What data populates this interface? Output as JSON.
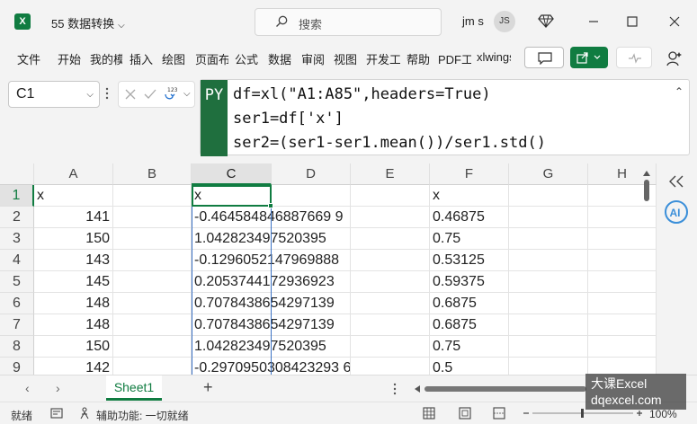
{
  "titlebar": {
    "doc_title": "55 数据转换",
    "search_placeholder": "搜索",
    "user_name": "jm s",
    "avatar_initials": "JS",
    "app_icon_letter": "X",
    "chevron": "⌵"
  },
  "ribbon": {
    "tabs": [
      "文件",
      "开始",
      "我的模板",
      "插入",
      "绘图",
      "页面布局",
      "公式",
      "数据",
      "审阅",
      "视图",
      "开发工具",
      "帮助",
      "PDF工具",
      "xlwings"
    ]
  },
  "formula_bar": {
    "name_box": "C1",
    "py_badge": "PY",
    "code_lines": [
      "df=xl(\"A1:A85\",headers=True)",
      "ser1=df['x']",
      "ser2=(ser1-ser1.mean())/ser1.std()"
    ]
  },
  "grid": {
    "columns": [
      "A",
      "B",
      "C",
      "D",
      "E",
      "F",
      "G",
      "H"
    ],
    "selected_column": "C",
    "rows": [
      {
        "num": "1",
        "A": "x",
        "C": "x",
        "F": "x"
      },
      {
        "num": "2",
        "A": "141",
        "C": "-0.464584846887669 9",
        "F": "0.46875"
      },
      {
        "num": "3",
        "A": "150",
        "C": "1.042823497520395",
        "F": "0.75"
      },
      {
        "num": "4",
        "A": "143",
        "C": "-0.1296052147969888",
        "F": "0.53125"
      },
      {
        "num": "5",
        "A": "145",
        "C": "0.2053744172936923",
        "F": "0.59375"
      },
      {
        "num": "6",
        "A": "148",
        "C": "0.7078438654297139",
        "F": "0.6875"
      },
      {
        "num": "7",
        "A": "148",
        "C": "0.7078438654297139",
        "F": "0.6875"
      },
      {
        "num": "8",
        "A": "150",
        "C": "1.042823497520395",
        "F": "0.75"
      },
      {
        "num": "9",
        "A": "142",
        "C": "-0.2970950308423293 6",
        "F": "0.5"
      }
    ]
  },
  "sheets": {
    "active": "Sheet1",
    "add_label": "+"
  },
  "status": {
    "ready": "就绪",
    "accessibility": "辅助功能: 一切就绪",
    "zoom": "100%"
  },
  "watermark": {
    "line1": "大课Excel",
    "line2": "dqexcel.com"
  },
  "colors": {
    "accent": "#107c41",
    "selection_outline": "#3b72c4"
  }
}
